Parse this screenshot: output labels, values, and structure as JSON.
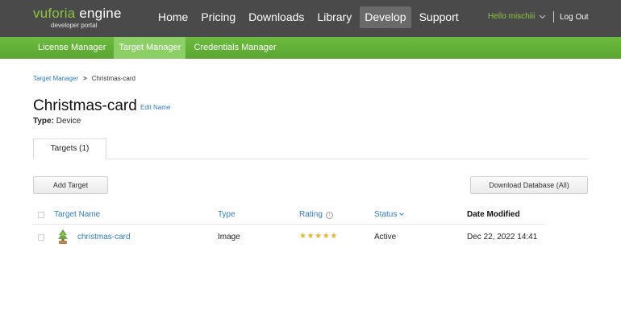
{
  "brand": {
    "name_left": "vuforia",
    "name_right": " engine",
    "subtitle": "developer portal"
  },
  "nav": {
    "items": [
      {
        "label": "Home",
        "active": false
      },
      {
        "label": "Pricing",
        "active": false
      },
      {
        "label": "Downloads",
        "active": false
      },
      {
        "label": "Library",
        "active": false
      },
      {
        "label": "Develop",
        "active": true
      },
      {
        "label": "Support",
        "active": false
      }
    ],
    "user_greeting": "Hello mischiii",
    "logout_label": "Log Out"
  },
  "subnav": {
    "items": [
      {
        "label": "License Manager",
        "active": false
      },
      {
        "label": "Target Manager",
        "active": true
      },
      {
        "label": "Credentials Manager",
        "active": false
      }
    ]
  },
  "breadcrumb": {
    "parent": "Target Manager",
    "separator": ">",
    "current": "Christmas-card"
  },
  "page": {
    "title": "Christmas-card",
    "edit_label": "Edit Name",
    "type_label": "Type:",
    "type_value": "Device"
  },
  "tabs": [
    {
      "label": "Targets (1)",
      "active": true
    }
  ],
  "actions": {
    "add_target": "Add Target",
    "download_database": "Download Database (All)"
  },
  "table": {
    "columns": {
      "name": "Target Name",
      "type": "Type",
      "rating": "Rating",
      "status": "Status",
      "date": "Date Modified"
    },
    "rows": [
      {
        "name": "christmas-card",
        "type": "Image",
        "rating": 5,
        "rating_max": 5,
        "status": "Active",
        "date": "Dec 22, 2022 14:41",
        "thumbnail": "christmas-tree-thumbnail"
      }
    ]
  },
  "icons": {
    "user_menu": "chevron-down-icon",
    "rating_info": "info-icon",
    "status_sort": "chevron-down-icon",
    "rating": "star-icon"
  },
  "colors": {
    "topbar": "#4a4a4a",
    "accent_green": "#8cc63f",
    "subnav_green": "#5aa532",
    "link_blue": "#2f7dc6",
    "star": "#e8b533"
  }
}
